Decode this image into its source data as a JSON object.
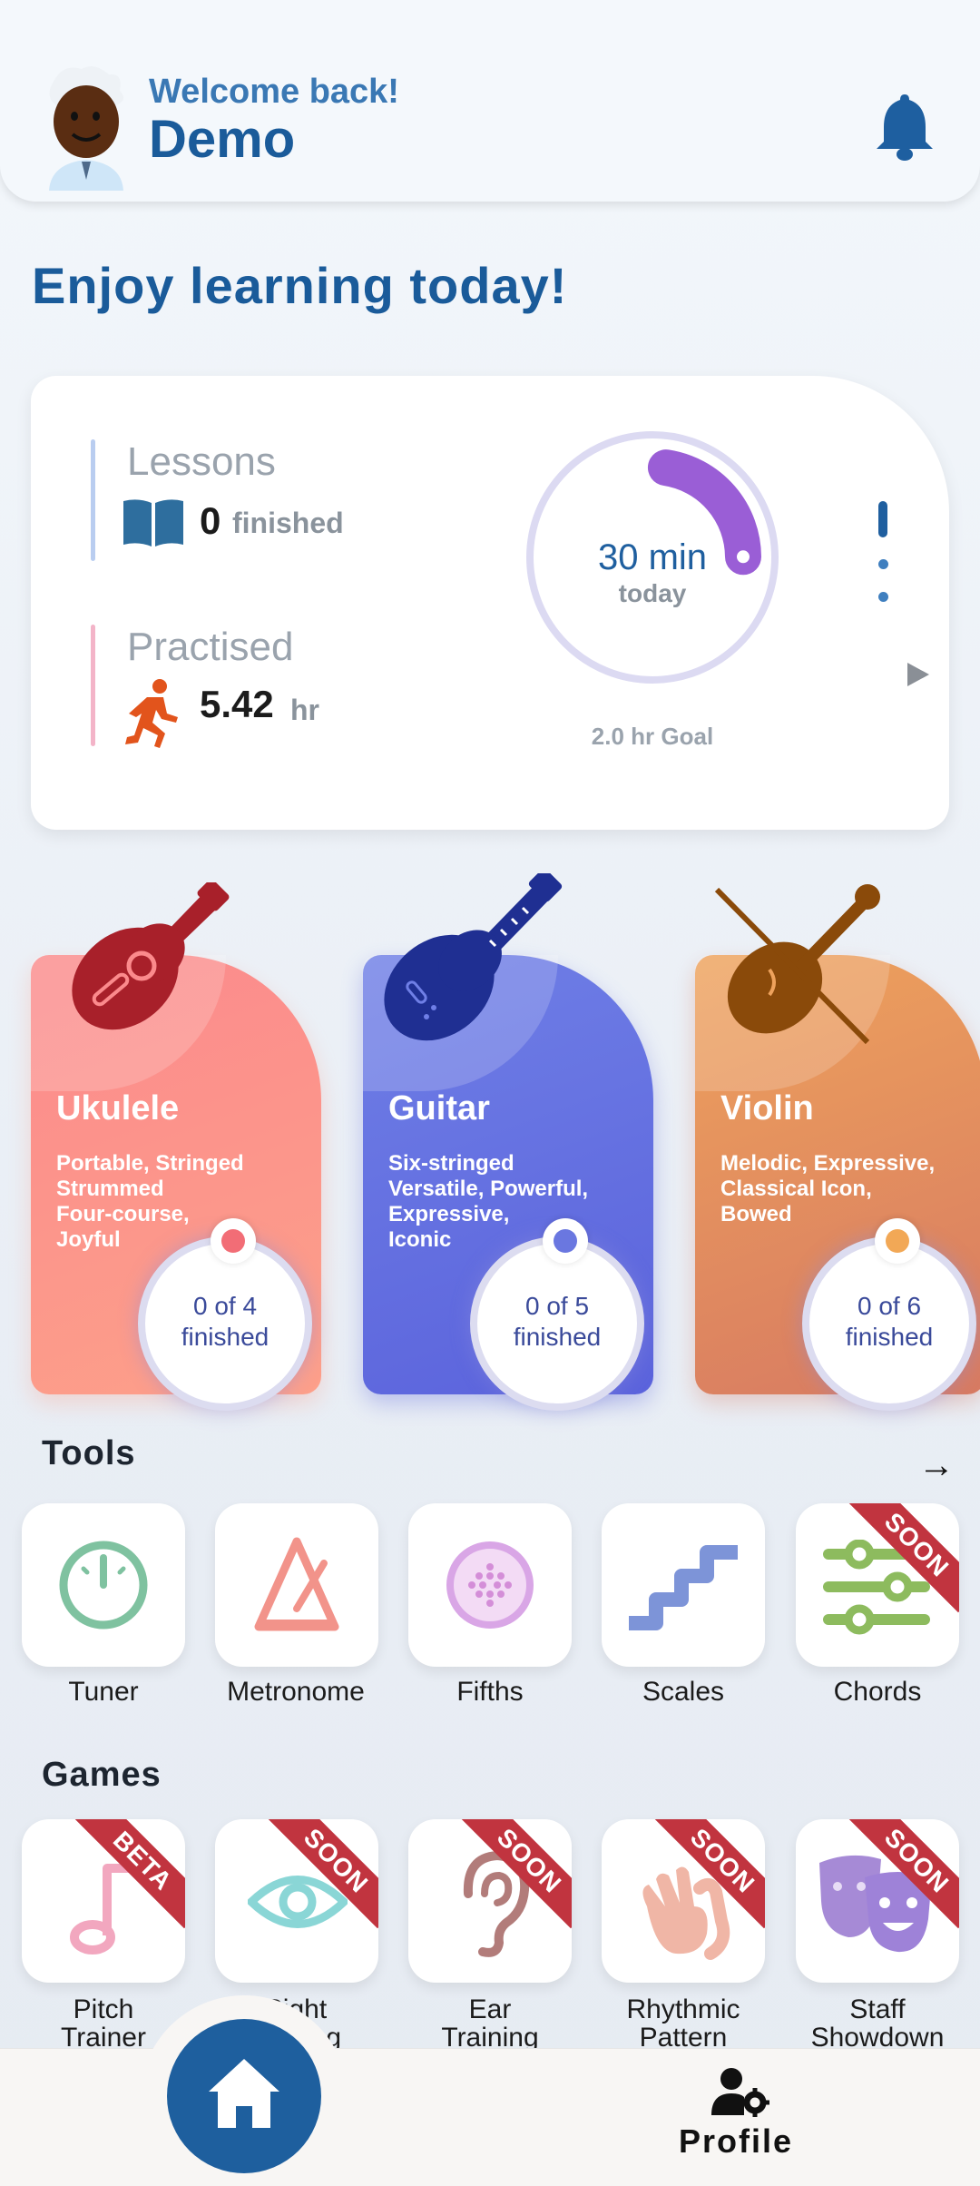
{
  "header": {
    "welcome": "Welcome back!",
    "username": "Demo"
  },
  "greeting": "Enjoy learning today!",
  "stats": {
    "lessons_title": "Lessons",
    "lessons_value": "0",
    "lessons_unit": "finished",
    "practised_title": "Practised",
    "practised_value": "5.42",
    "practised_unit": "hr",
    "ring_value": "30 min",
    "ring_sub": "today",
    "goal": "2.0 hr Goal",
    "ring_progress_fraction": 0.25
  },
  "instruments": [
    {
      "name": "Ukulele",
      "desc": [
        "Portable, Stringed",
        "Strummed",
        "Four-course,",
        "Joyful"
      ],
      "progress_line1": "0 of 4",
      "progress_line2": "finished",
      "color_from": "#fb8a8c",
      "color_to": "#fda08a",
      "accent": "#f26d76"
    },
    {
      "name": "Guitar",
      "desc": [
        "Six-stringed",
        "Versatile, Powerful,",
        "Expressive,",
        "Iconic"
      ],
      "progress_line1": "0 of 5",
      "progress_line2": "finished",
      "color_from": "#6f7fe6",
      "color_to": "#5b63dc",
      "accent": "#6a77e0"
    },
    {
      "name": "Violin",
      "desc": [
        "Melodic, Expressive,",
        "Classical Icon,",
        "Bowed"
      ],
      "progress_line1": "0 of 6",
      "progress_line2": "finished",
      "color_from": "#eea25c",
      "color_to": "#d77a62",
      "accent": "#f2a856"
    }
  ],
  "tools_title": "Tools",
  "tools": [
    {
      "label": "Tuner",
      "icon": "tuner-icon"
    },
    {
      "label": "Metronome",
      "icon": "metronome-icon"
    },
    {
      "label": "Fifths",
      "icon": "fifths-icon"
    },
    {
      "label": "Scales",
      "icon": "scales-icon"
    },
    {
      "label": "Chords",
      "icon": "chords-icon",
      "badge": "SOON"
    }
  ],
  "games_title": "Games",
  "games": [
    {
      "label": "Pitch\nTrainer",
      "line1": "Pitch",
      "line2": "Trainer",
      "badge": "BETA"
    },
    {
      "label": "Sight\nSinging",
      "line1": "Sight",
      "line2": "Singing",
      "badge": "SOON"
    },
    {
      "label": "Ear\nTraining",
      "line1": "Ear",
      "line2": "Training",
      "badge": "SOON"
    },
    {
      "label": "Rhythmic\nPattern",
      "line1": "Rhythmic",
      "line2": "Pattern",
      "badge": "SOON"
    },
    {
      "label": "Staff\nShowdown",
      "line1": "Staff",
      "line2": "Showdown",
      "badge": "SOON"
    }
  ],
  "nav": {
    "profile": "Profile"
  },
  "arrow": "→"
}
